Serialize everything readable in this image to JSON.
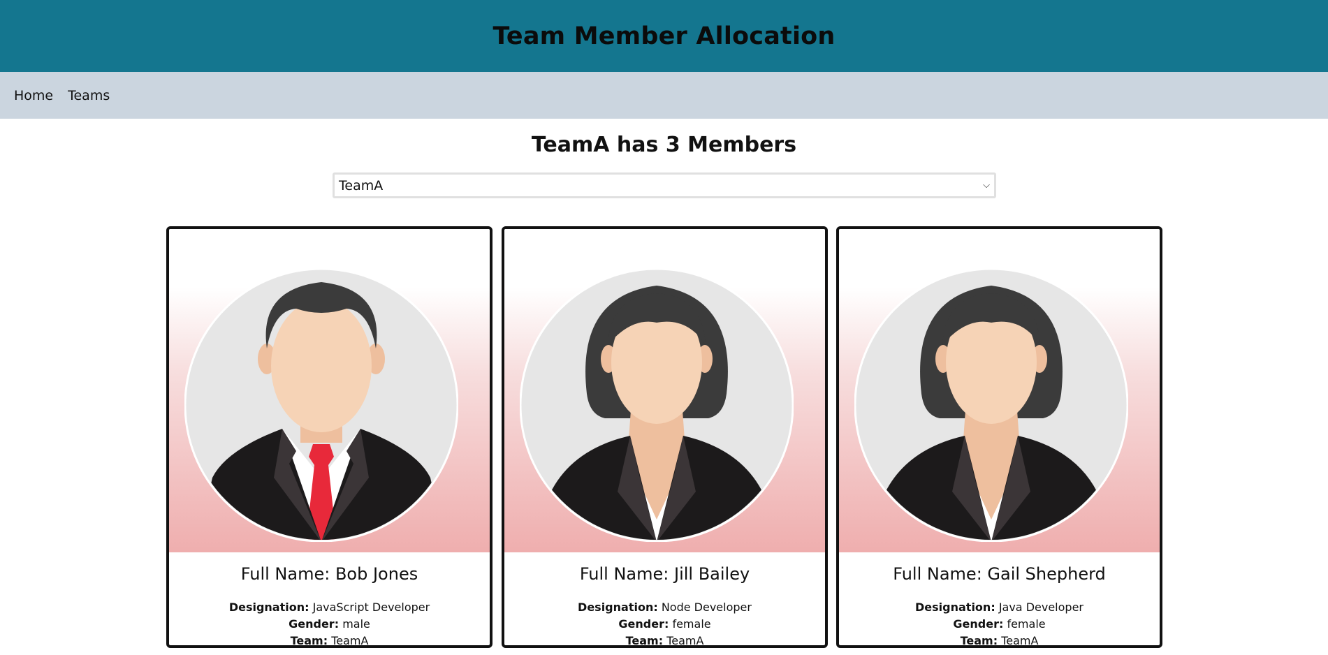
{
  "header": {
    "title": "Team Member Allocation"
  },
  "nav": {
    "items": [
      {
        "label": "Home"
      },
      {
        "label": "Teams"
      }
    ]
  },
  "main": {
    "heading": "TeamA has 3 Members",
    "team_select": {
      "value": "TeamA"
    }
  },
  "labels": {
    "full_name": "Full Name: ",
    "designation": "Designation:",
    "gender": "Gender:",
    "team": "Team:"
  },
  "members": [
    {
      "full_name": "Bob Jones",
      "designation": "JavaScript Developer",
      "gender": "male",
      "team": "TeamA",
      "avatar": "male-avatar"
    },
    {
      "full_name": "Jill Bailey",
      "designation": "Node Developer",
      "gender": "female",
      "team": "TeamA",
      "avatar": "female-avatar"
    },
    {
      "full_name": "Gail Shepherd",
      "designation": "Java Developer",
      "gender": "female",
      "team": "TeamA",
      "avatar": "female-avatar"
    }
  ],
  "colors": {
    "header_bg": "#14768f",
    "nav_bg": "#cbd5df",
    "card_gradient_end": "#efaeae"
  }
}
